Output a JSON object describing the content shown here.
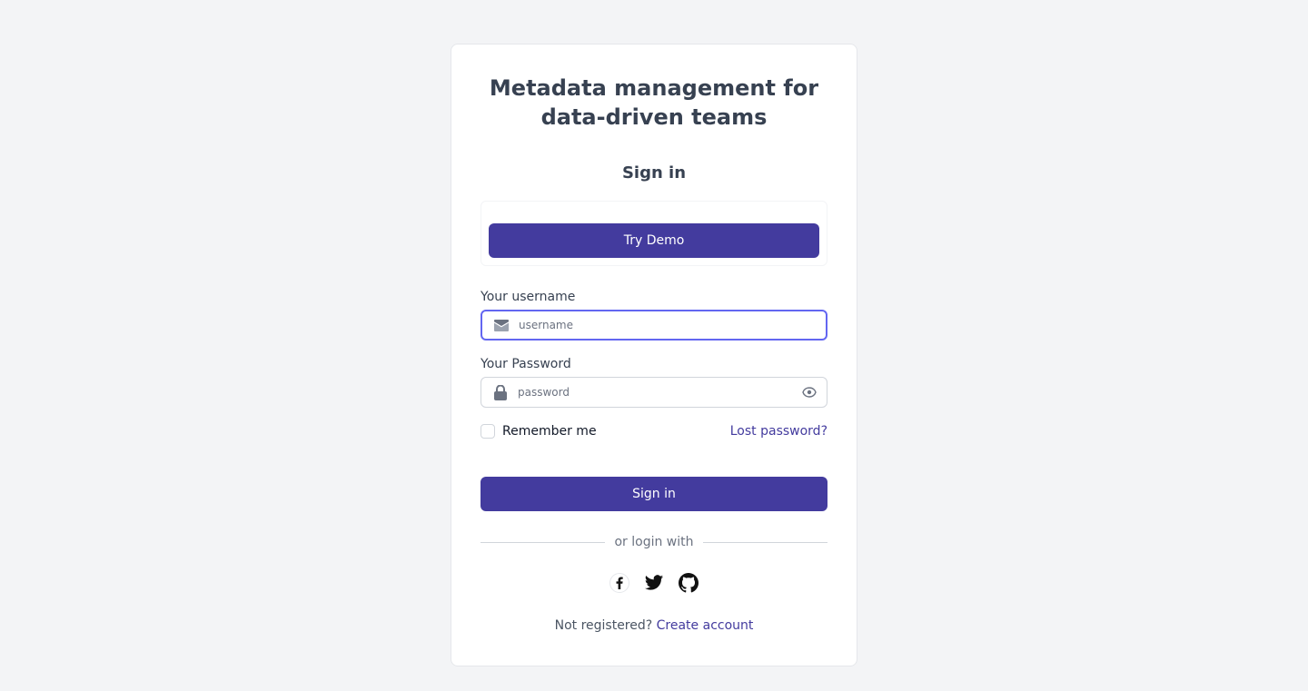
{
  "headline": "Metadata management for data-driven teams",
  "subtitle": "Sign in",
  "demo": {
    "button_label": "Try Demo"
  },
  "username": {
    "label": "Your username",
    "placeholder": "username",
    "value": "",
    "icon": "envelope-icon"
  },
  "password": {
    "label": "Your Password",
    "placeholder": "password",
    "value": "",
    "icon": "lock-icon",
    "toggle_icon": "eye-icon"
  },
  "remember": {
    "label": "Remember me",
    "checked": false
  },
  "lost_password": "Lost password?",
  "signin_button": "Sign in",
  "divider_text": "or login with",
  "social": [
    {
      "icon": "facebook-icon"
    },
    {
      "icon": "twitter-icon"
    },
    {
      "icon": "github-icon"
    }
  ],
  "register": {
    "prompt": "Not registered?",
    "link": "Create account"
  },
  "colors": {
    "background": "#f3f4f6",
    "primary": "#433b9e",
    "focus_border": "#6366f1",
    "text": "#374151"
  }
}
